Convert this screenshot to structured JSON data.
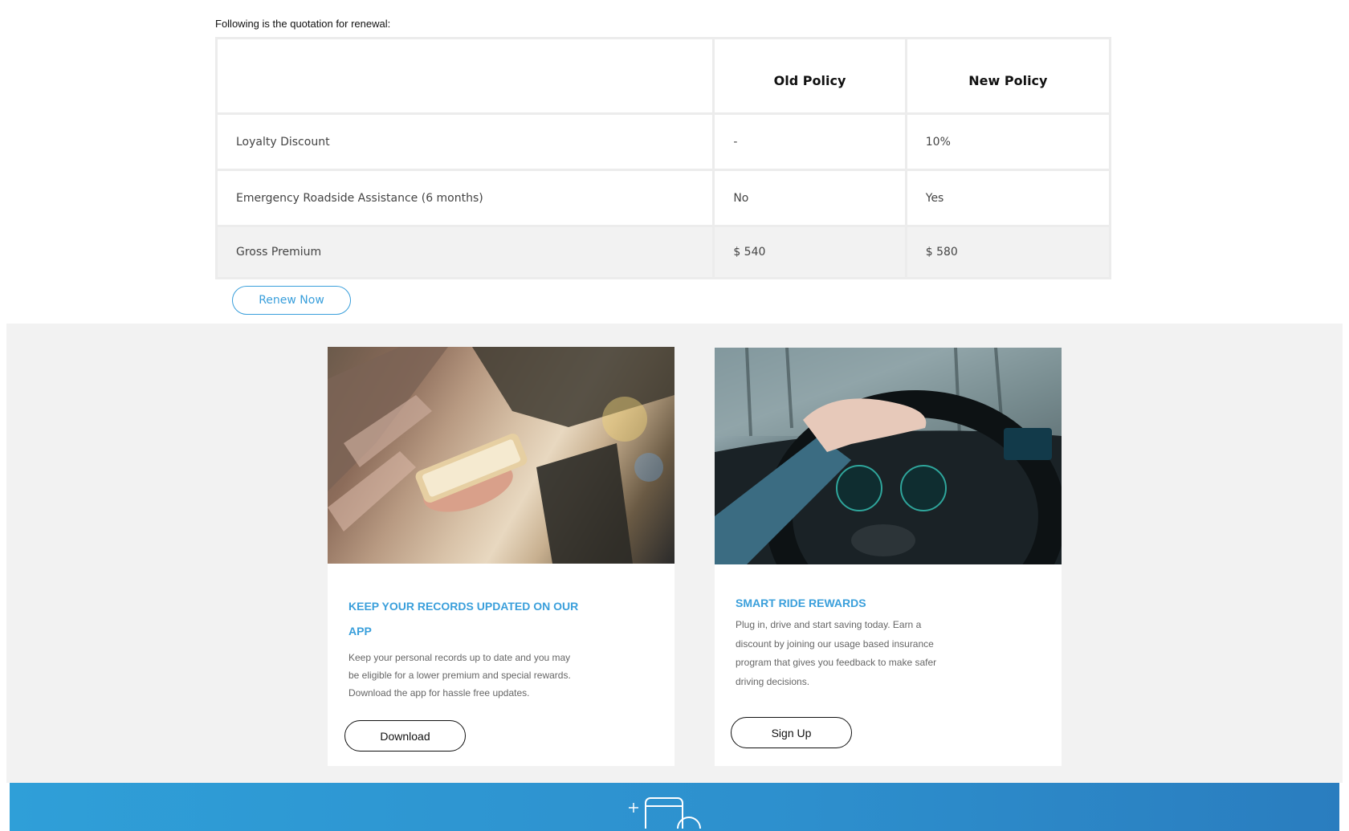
{
  "intro": "Following is the quotation for renewal:",
  "table": {
    "headers": [
      "",
      "Old Policy",
      "New Policy"
    ],
    "rows": [
      {
        "label": "Loyalty Discount",
        "old": "-",
        "new": "10%"
      },
      {
        "label": "Emergency Roadside Assistance (6 months)",
        "old": "No",
        "new": "Yes"
      },
      {
        "label": "Gross Premium",
        "old": "$ 540",
        "new": "$ 580"
      }
    ]
  },
  "renew_button": "Renew Now",
  "cards": [
    {
      "title": "KEEP YOUR RECORDS UPDATED ON OUR APP",
      "body": "Keep your personal records up to date and you may be eligible for a lower premium and special rewards. Download the app for hassle free updates.",
      "button": "Download",
      "image": "woman-holding-smartphone-photo"
    },
    {
      "title": "SMART RIDE REWARDS",
      "body": "Plug in, drive and start saving today. Earn a discount by joining our usage based insurance program that gives you feedback to make safer driving decisions.",
      "button": "Sign Up",
      "image": "hand-on-steering-wheel-photo"
    }
  ],
  "footer_icon": "mobile-phone-icon",
  "colors": {
    "accent": "#3a9fdb",
    "band": "#f2f2f2",
    "footer": "#2f9fd8"
  }
}
